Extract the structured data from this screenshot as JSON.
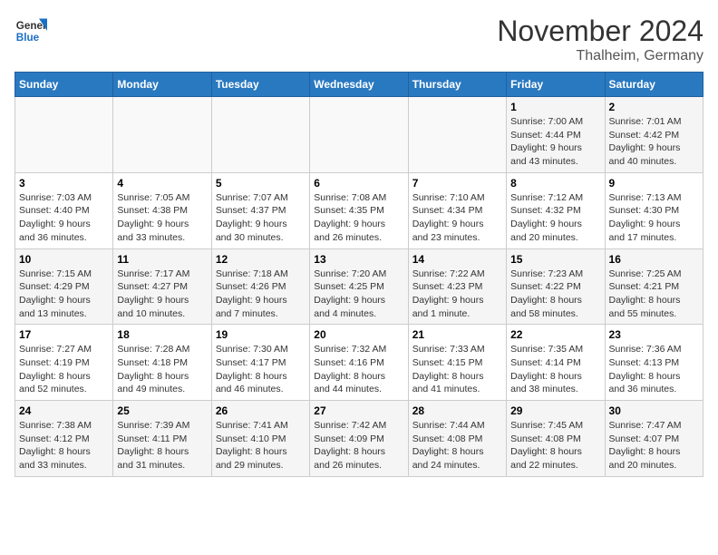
{
  "header": {
    "logo_general": "General",
    "logo_blue": "Blue",
    "month_title": "November 2024",
    "location": "Thalheim, Germany"
  },
  "days_of_week": [
    "Sunday",
    "Monday",
    "Tuesday",
    "Wednesday",
    "Thursday",
    "Friday",
    "Saturday"
  ],
  "weeks": [
    [
      {
        "day": "",
        "info": ""
      },
      {
        "day": "",
        "info": ""
      },
      {
        "day": "",
        "info": ""
      },
      {
        "day": "",
        "info": ""
      },
      {
        "day": "",
        "info": ""
      },
      {
        "day": "1",
        "info": "Sunrise: 7:00 AM\nSunset: 4:44 PM\nDaylight: 9 hours\nand 43 minutes."
      },
      {
        "day": "2",
        "info": "Sunrise: 7:01 AM\nSunset: 4:42 PM\nDaylight: 9 hours\nand 40 minutes."
      }
    ],
    [
      {
        "day": "3",
        "info": "Sunrise: 7:03 AM\nSunset: 4:40 PM\nDaylight: 9 hours\nand 36 minutes."
      },
      {
        "day": "4",
        "info": "Sunrise: 7:05 AM\nSunset: 4:38 PM\nDaylight: 9 hours\nand 33 minutes."
      },
      {
        "day": "5",
        "info": "Sunrise: 7:07 AM\nSunset: 4:37 PM\nDaylight: 9 hours\nand 30 minutes."
      },
      {
        "day": "6",
        "info": "Sunrise: 7:08 AM\nSunset: 4:35 PM\nDaylight: 9 hours\nand 26 minutes."
      },
      {
        "day": "7",
        "info": "Sunrise: 7:10 AM\nSunset: 4:34 PM\nDaylight: 9 hours\nand 23 minutes."
      },
      {
        "day": "8",
        "info": "Sunrise: 7:12 AM\nSunset: 4:32 PM\nDaylight: 9 hours\nand 20 minutes."
      },
      {
        "day": "9",
        "info": "Sunrise: 7:13 AM\nSunset: 4:30 PM\nDaylight: 9 hours\nand 17 minutes."
      }
    ],
    [
      {
        "day": "10",
        "info": "Sunrise: 7:15 AM\nSunset: 4:29 PM\nDaylight: 9 hours\nand 13 minutes."
      },
      {
        "day": "11",
        "info": "Sunrise: 7:17 AM\nSunset: 4:27 PM\nDaylight: 9 hours\nand 10 minutes."
      },
      {
        "day": "12",
        "info": "Sunrise: 7:18 AM\nSunset: 4:26 PM\nDaylight: 9 hours\nand 7 minutes."
      },
      {
        "day": "13",
        "info": "Sunrise: 7:20 AM\nSunset: 4:25 PM\nDaylight: 9 hours\nand 4 minutes."
      },
      {
        "day": "14",
        "info": "Sunrise: 7:22 AM\nSunset: 4:23 PM\nDaylight: 9 hours\nand 1 minute."
      },
      {
        "day": "15",
        "info": "Sunrise: 7:23 AM\nSunset: 4:22 PM\nDaylight: 8 hours\nand 58 minutes."
      },
      {
        "day": "16",
        "info": "Sunrise: 7:25 AM\nSunset: 4:21 PM\nDaylight: 8 hours\nand 55 minutes."
      }
    ],
    [
      {
        "day": "17",
        "info": "Sunrise: 7:27 AM\nSunset: 4:19 PM\nDaylight: 8 hours\nand 52 minutes."
      },
      {
        "day": "18",
        "info": "Sunrise: 7:28 AM\nSunset: 4:18 PM\nDaylight: 8 hours\nand 49 minutes."
      },
      {
        "day": "19",
        "info": "Sunrise: 7:30 AM\nSunset: 4:17 PM\nDaylight: 8 hours\nand 46 minutes."
      },
      {
        "day": "20",
        "info": "Sunrise: 7:32 AM\nSunset: 4:16 PM\nDaylight: 8 hours\nand 44 minutes."
      },
      {
        "day": "21",
        "info": "Sunrise: 7:33 AM\nSunset: 4:15 PM\nDaylight: 8 hours\nand 41 minutes."
      },
      {
        "day": "22",
        "info": "Sunrise: 7:35 AM\nSunset: 4:14 PM\nDaylight: 8 hours\nand 38 minutes."
      },
      {
        "day": "23",
        "info": "Sunrise: 7:36 AM\nSunset: 4:13 PM\nDaylight: 8 hours\nand 36 minutes."
      }
    ],
    [
      {
        "day": "24",
        "info": "Sunrise: 7:38 AM\nSunset: 4:12 PM\nDaylight: 8 hours\nand 33 minutes."
      },
      {
        "day": "25",
        "info": "Sunrise: 7:39 AM\nSunset: 4:11 PM\nDaylight: 8 hours\nand 31 minutes."
      },
      {
        "day": "26",
        "info": "Sunrise: 7:41 AM\nSunset: 4:10 PM\nDaylight: 8 hours\nand 29 minutes."
      },
      {
        "day": "27",
        "info": "Sunrise: 7:42 AM\nSunset: 4:09 PM\nDaylight: 8 hours\nand 26 minutes."
      },
      {
        "day": "28",
        "info": "Sunrise: 7:44 AM\nSunset: 4:08 PM\nDaylight: 8 hours\nand 24 minutes."
      },
      {
        "day": "29",
        "info": "Sunrise: 7:45 AM\nSunset: 4:08 PM\nDaylight: 8 hours\nand 22 minutes."
      },
      {
        "day": "30",
        "info": "Sunrise: 7:47 AM\nSunset: 4:07 PM\nDaylight: 8 hours\nand 20 minutes."
      }
    ]
  ]
}
